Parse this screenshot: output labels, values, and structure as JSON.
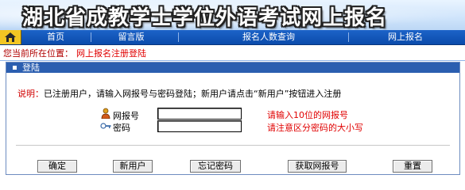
{
  "header": {
    "title": "湖北省成教学士学位外语考试网上报名"
  },
  "nav": {
    "items": [
      {
        "label": "首页"
      },
      {
        "label": "留言版"
      },
      {
        "label": "报名人数查询"
      },
      {
        "label": "网上报名"
      }
    ],
    "home_icon": "home-icon"
  },
  "location": {
    "prefix": "您当前所在位置：",
    "current": "网上报名注册登陆"
  },
  "panel": {
    "title": "登陆",
    "desc_key": "说明：",
    "desc_text": "已注册用户，请输入网报号与密码登陆；新用户请点击“新用户”按钮进入注册"
  },
  "form": {
    "username_label": "网报号",
    "password_label": "密码",
    "username_value": "",
    "password_value": "",
    "username_hint": "请输入10位的网报号",
    "password_hint": "请注意区分密码的大小写",
    "user_icon": "user-icon",
    "key_icon": "key-icon"
  },
  "buttons": {
    "confirm": "确定",
    "new_user": "新用户",
    "forgot_password": "忘记密码",
    "get_number": "获取网报号",
    "reset": "重置"
  }
}
